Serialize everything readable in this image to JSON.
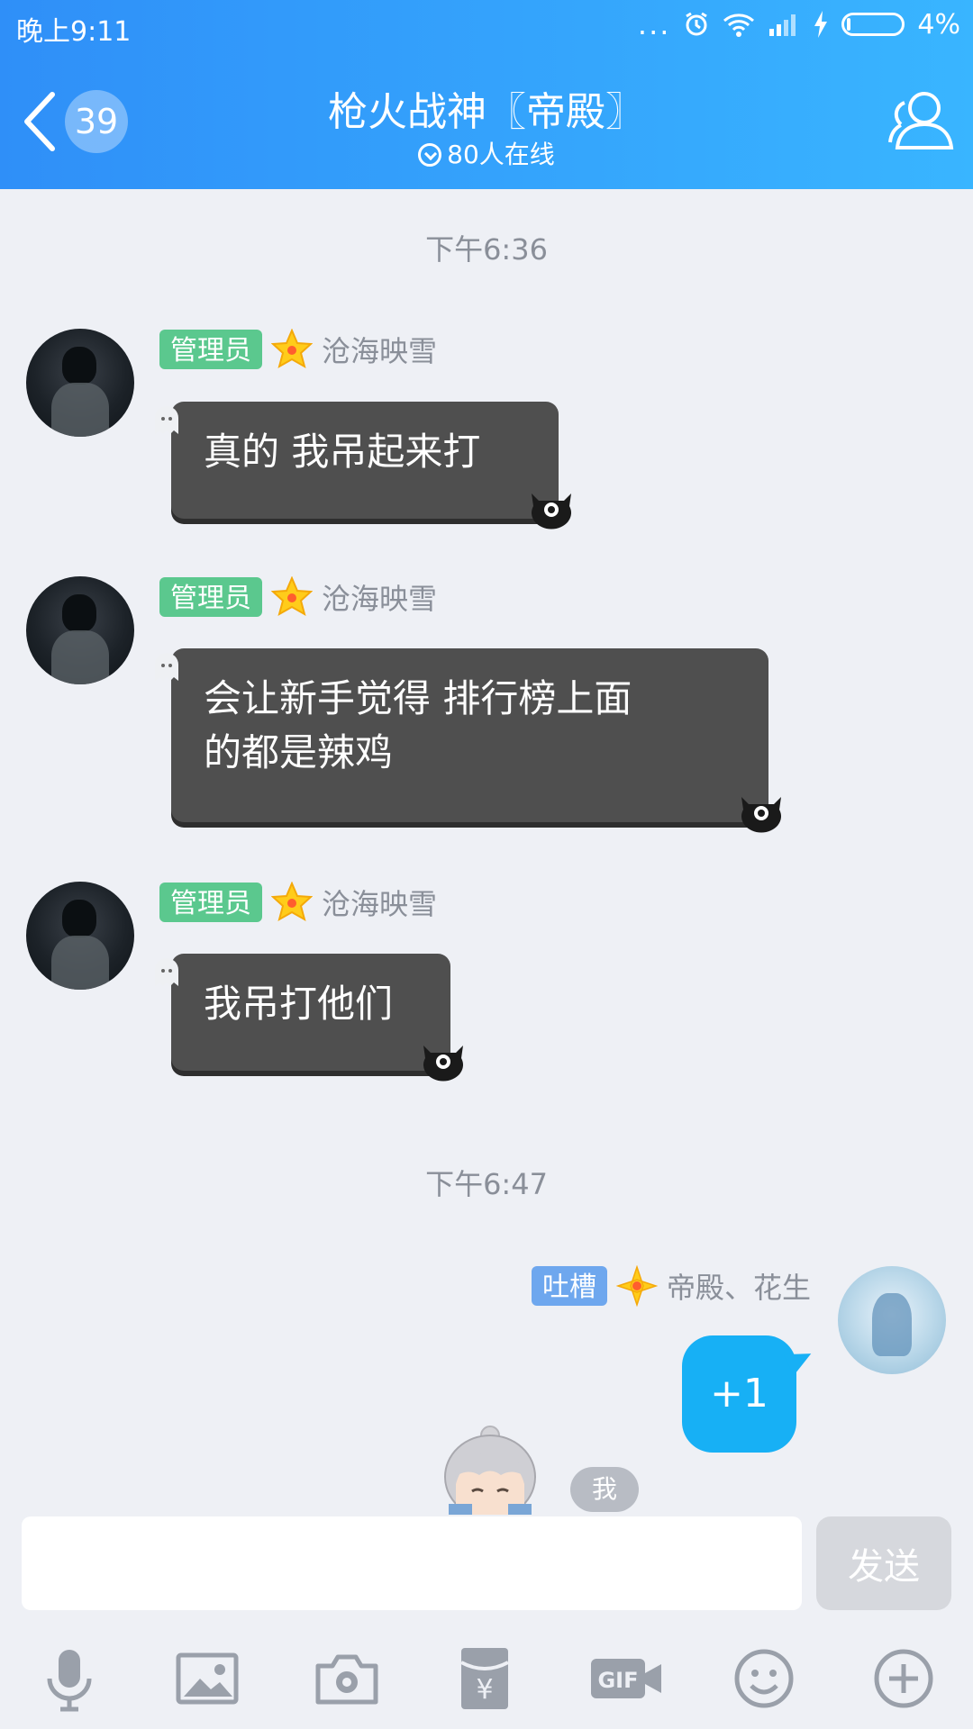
{
  "status_bar": {
    "time": "晚上9:11",
    "battery": "4%",
    "more": "..."
  },
  "header": {
    "unread_count": "39",
    "title": "枪火战神〖帝殿〗",
    "online": "80人在线"
  },
  "messages": [
    {
      "timestamp": "下午6:36"
    },
    {
      "role": "管理员",
      "name": "沧海映雪",
      "text": "真的  我吊起来打"
    },
    {
      "role": "管理员",
      "name": "沧海映雪",
      "text_line1": "会让新手觉得  排行榜上面",
      "text_line2": "的都是辣鸡"
    },
    {
      "role": "管理员",
      "name": "沧海映雪",
      "text": "我吊打他们"
    },
    {
      "timestamp": "下午6:47"
    },
    {
      "role": "吐槽",
      "name": "帝殿、花生",
      "text": "+1"
    }
  ],
  "sticker_tag": "我",
  "input": {
    "placeholder": "",
    "send_label": "发送"
  },
  "toolbar": [
    "microphone-icon",
    "image-icon",
    "camera-icon",
    "red-packet-icon",
    "gif-icon",
    "emoji-icon",
    "plus-icon"
  ],
  "colors": {
    "header_start": "#2f8ff8",
    "header_end": "#39b5ff",
    "admin_tag": "#5bc88e",
    "tucao_tag": "#6ea7ee",
    "self_bubble": "#17b0f5",
    "other_bubble": "#4f4f4f"
  }
}
